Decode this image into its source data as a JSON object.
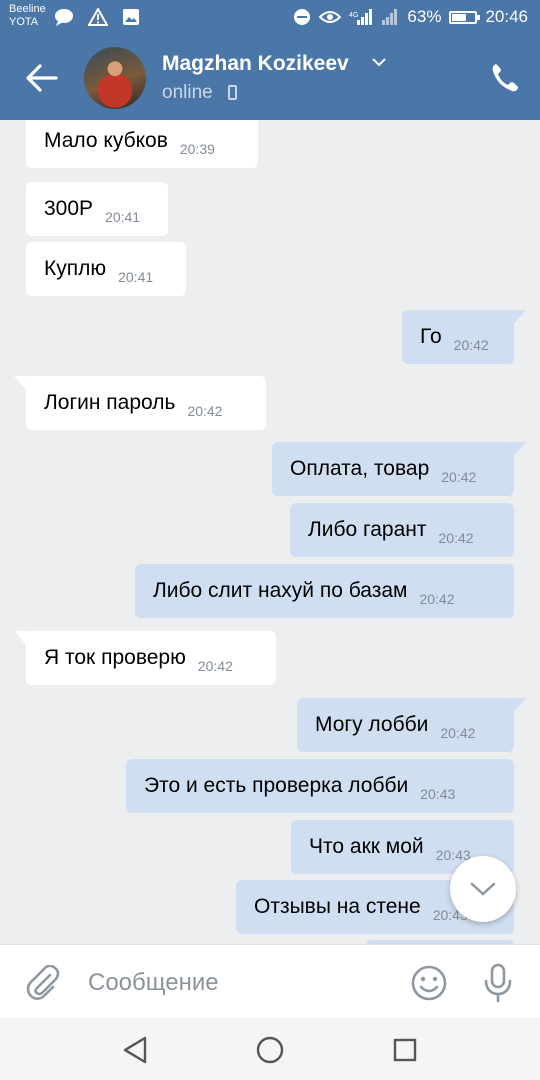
{
  "status_bar": {
    "carrier_1": "Beeline",
    "carrier_2": "YOTA",
    "battery": "63%",
    "battery_level": 0.63,
    "time": "20:46"
  },
  "header": {
    "name": "Magzhan Kozikeev",
    "status": "online"
  },
  "messages": [
    {
      "text": "Мало кубков",
      "time": "20:39",
      "dir": "in"
    },
    {
      "text": "300Р",
      "time": "20:41",
      "dir": "in"
    },
    {
      "text": "Куплю",
      "time": "20:41",
      "dir": "in"
    },
    {
      "text": "Го",
      "time": "20:42",
      "dir": "out"
    },
    {
      "text": "Логин пароль",
      "time": "20:42",
      "dir": "in"
    },
    {
      "text": "Оплата, товар",
      "time": "20:42",
      "dir": "out"
    },
    {
      "text": "Либо гарант",
      "time": "20:42",
      "dir": "out"
    },
    {
      "text": "Либо слит нахуй по базам",
      "time": "20:42",
      "dir": "out"
    },
    {
      "text": "Я ток проверю",
      "time": "20:42",
      "dir": "in"
    },
    {
      "text": "Могу лобби",
      "time": "20:42",
      "dir": "out"
    },
    {
      "text": "Это и есть проверка лобби",
      "time": "20:43",
      "dir": "out"
    },
    {
      "text": "Что акк мой",
      "time": "20:43",
      "dir": "out"
    },
    {
      "text": "Отзывы на стене",
      "time": "20:43",
      "dir": "out"
    }
  ],
  "composer": {
    "placeholder": "Сообщение"
  },
  "colors": {
    "header_bg": "#4a76a8",
    "chat_bg": "#edeef0",
    "bubble_in": "#ffffff",
    "bubble_out": "#cfdef0",
    "icon_gray": "#8f97a1"
  },
  "icons": {
    "back": "arrow-left-icon",
    "call": "phone-icon",
    "attach": "paperclip-icon",
    "emoji": "smiley-icon",
    "mic": "microphone-icon",
    "scroll_down": "chevron-down-icon"
  }
}
